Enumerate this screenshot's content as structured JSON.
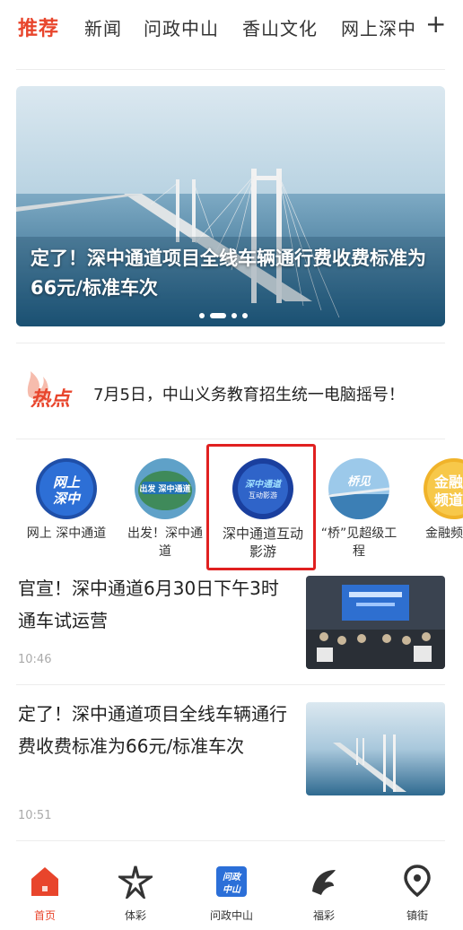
{
  "top_tabs": [
    "推荐",
    "新闻",
    "问政中山",
    "香山文化",
    "网上深中"
  ],
  "add_tab_symbol": "+",
  "banner": {
    "headline": "定了！深中通道项目全线车辆通行费收费标准为 66元/标准车次",
    "slide_count": 4,
    "active_slide": 1
  },
  "hot": {
    "badge_text": "热点",
    "headline": "7月5日，中山义务教育招生统一电脑摇号！"
  },
  "features": [
    {
      "label": "网上 深中通道",
      "icon_text": "网上深中"
    },
    {
      "label": "出发！深中通道",
      "icon_text": "出发 深中通道"
    },
    {
      "label": "深中通道互动影游",
      "icon_text": "深中通道"
    },
    {
      "label": "“桥”见超级工程",
      "icon_text": "桥见"
    },
    {
      "label": "金融频",
      "icon_text": "金融频道"
    }
  ],
  "news": [
    {
      "title": "官宣！深中通道6月30日下午3时通车试运营",
      "time": "10:46"
    },
    {
      "title": "定了！深中通道项目全线车辆通行费收费标准为66元/标准车次",
      "time": "10:51"
    }
  ],
  "bottom_nav": [
    {
      "label": "首页",
      "icon": "home-icon",
      "active": true
    },
    {
      "label": "体彩",
      "icon": "sports-lottery-icon"
    },
    {
      "label": "问政中山",
      "icon": "wenzheng-icon",
      "icon_text": "问政中山"
    },
    {
      "label": "福彩",
      "icon": "welfare-lottery-icon"
    },
    {
      "label": "镇街",
      "icon": "location-pin-icon"
    }
  ],
  "colors": {
    "accent": "#e8452c",
    "highlight_box": "#e02020"
  }
}
